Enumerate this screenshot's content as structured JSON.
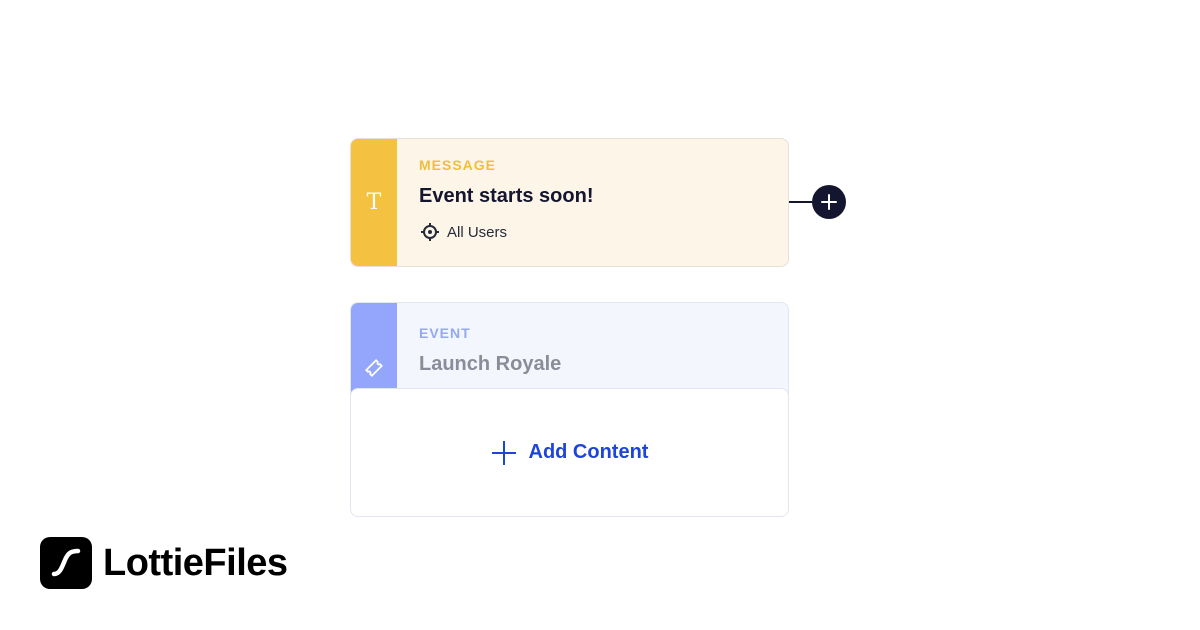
{
  "message_card": {
    "type_label": "MESSAGE",
    "title": "Event starts soon!",
    "audience": "All Users",
    "type_icon": "text-icon",
    "type_icon_glyph": "T",
    "audience_icon": "target-icon",
    "accent_color": "#f4c141"
  },
  "connector": {
    "add_icon": "plus-icon",
    "color": "#14152e"
  },
  "event_card": {
    "type_label": "EVENT",
    "title": "Launch Royale",
    "type_icon": "ticket-icon",
    "accent_color": "#93a6fb",
    "add_content_label": "Add Content",
    "add_content_icon": "plus-icon",
    "add_content_color": "#1d45d8"
  },
  "logo": {
    "name": "LottieFiles",
    "icon": "lottiefiles-logo-icon"
  }
}
